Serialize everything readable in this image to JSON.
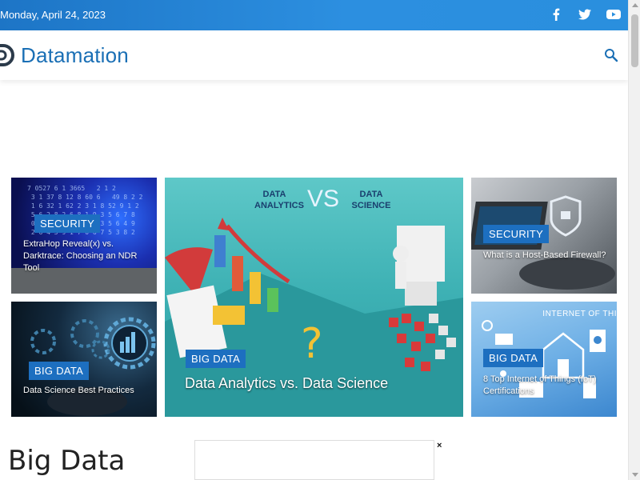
{
  "topbar": {
    "date": "Monday, April 24, 2023",
    "social": [
      "facebook-icon",
      "twitter-icon",
      "youtube-icon"
    ]
  },
  "header": {
    "logo_text": "Datamation",
    "brand_color": "#1a6fb5",
    "search_icon": "search-icon"
  },
  "featured": [
    {
      "category": "SECURITY",
      "title": "ExtraHop Reveal(x) vs. Darktrace: Choosing an NDR Tool"
    },
    {
      "category": "BIG DATA",
      "title": "Data Science Best Practices"
    },
    {
      "category": "BIG DATA",
      "title": "Data Analytics vs. Data Science",
      "image_text": {
        "left": "DATA ANALYTICS",
        "vs": "VS",
        "right": "DATA SCIENCE"
      }
    },
    {
      "category": "SECURITY",
      "title": "What is a Host-Based Firewall?"
    },
    {
      "category": "BIG DATA",
      "title": "8 Top Internet of Things (IoT) Certifications",
      "image_text": "INTERNET OF THI"
    }
  ],
  "section": {
    "title": "Big Data"
  },
  "ad": {
    "close": "×"
  },
  "colors": {
    "topbar": "#2a8fde",
    "label": "#1d6fc0"
  }
}
